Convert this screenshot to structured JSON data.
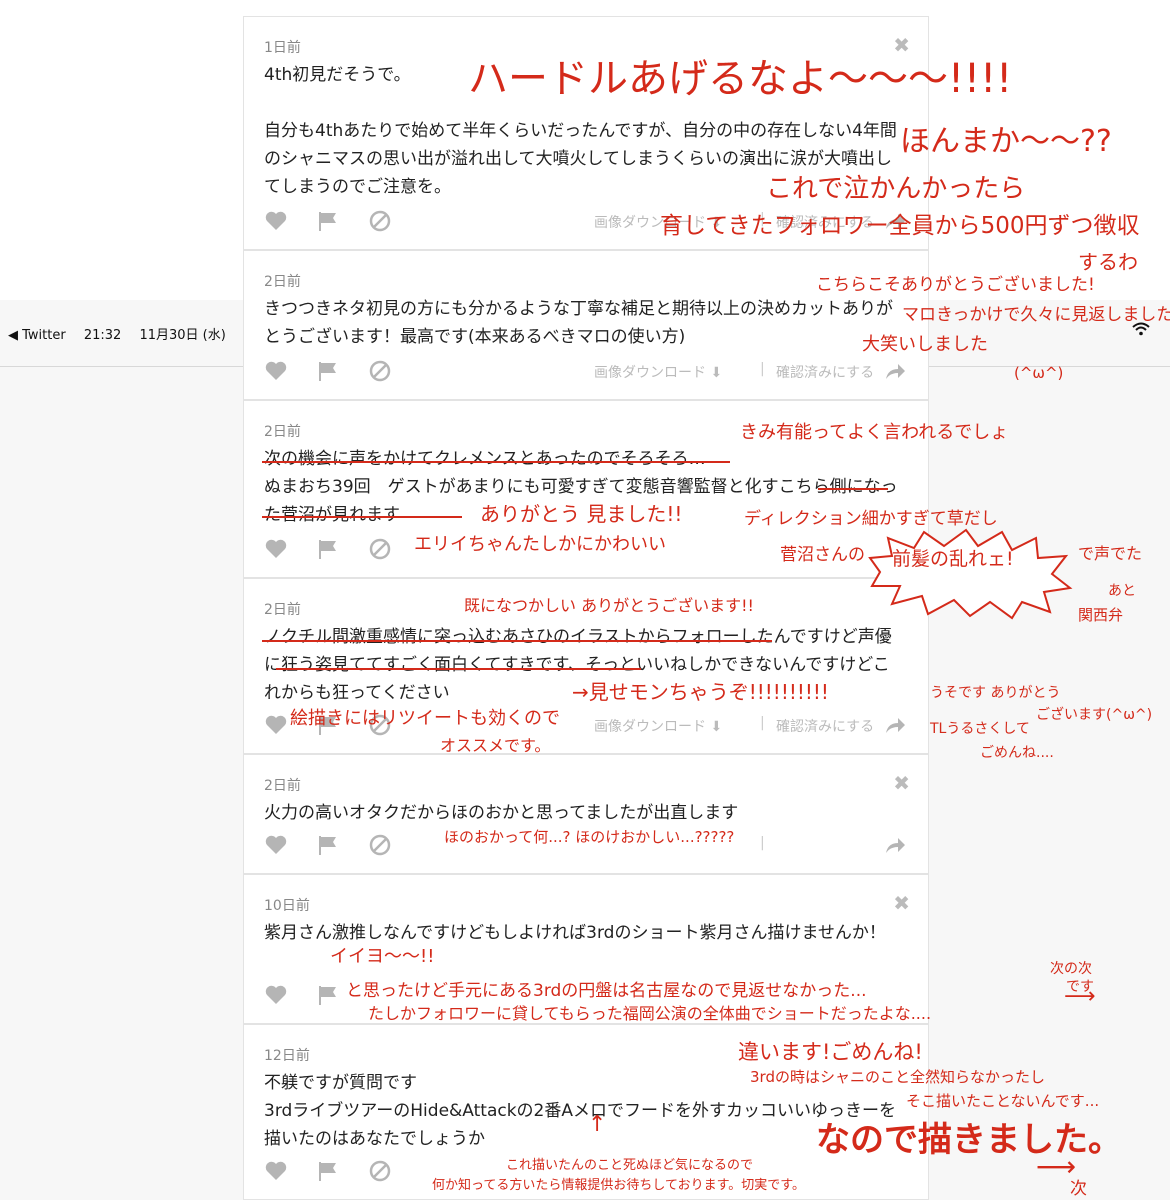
{
  "status_bar": {
    "back_app": "◀ Twitter",
    "time": "21:32",
    "date": "11月30日 (水)"
  },
  "action_labels": {
    "image_download": "画像ダウンロード",
    "mark_confirmed": "確認済みにする"
  },
  "cards": [
    {
      "time": "1日前",
      "body": "4th初見だそうで。\n\n自分も4thあたりで始めて半年くらいだったんですが、自分の中の存在しない4年間のシャニマスの思い出が溢れ出して大噴火してしまうくらいの演出に涙が大噴出してしまうのでご注意を。"
    },
    {
      "time": "2日前",
      "body": "きつつきネタ初見の方にも分かるような丁寧な補足と期待以上の決めカットありがとうございます！最高です(本来あるべきマロの使い方)"
    },
    {
      "time": "2日前",
      "body": "次の機会に声をかけてクレメンスとあったのでそろそろ…\nぬまおち39回　ゲストがあまりにも可愛すぎて変態音響監督と化すこちら側になった菅沼が見れます"
    },
    {
      "time": "2日前",
      "body": "ノクチル間激重感情に突っ込むあさひのイラストからフォローしたんですけど声優に狂う姿見ててすごく面白くてすきです、そっといいねしかできないんですけどこれからも狂ってください"
    },
    {
      "time": "2日前",
      "body": "火力の高いオタクだからほのおかと思ってましたが出直します"
    },
    {
      "time": "10日前",
      "body": "紫月さん激推しなんですけどもしよければ3rdのショート紫月さん描けませんか！"
    },
    {
      "time": "12日前",
      "body": "不躾ですが質問です\n3rdライブツアーのHide&Attackの2番Aメロでフードを外すカッコいいゆっきーを描いたのはあなたでしょうか"
    }
  ],
  "annotations": [
    "ハードルあげるなよ〜〜〜!!!!",
    "ほんまか〜〜??",
    "これで泣かんかったら",
    "育してきたフォロワー全員から500円ずつ徴収",
    "するわ",
    "こちらこそありがとうございました!",
    "マロきっかけで久々に見返しました",
    "大笑いしました",
    "(^ω^)",
    "きみ有能ってよく言われるでしょ",
    "ありがとう 見ました!!",
    "ディレクション細かすぎて草だし",
    "エリイちゃんたしかにかわいい",
    "菅沼さんの",
    "前髪の乱れェ!",
    "で声でた",
    "あと",
    "関西弁",
    "既になつかしい ありがとうございます!!",
    "→見せモンちゃうぞ!!!!!!!!!!",
    "うそです ありがとう",
    "ございます(^ω^)",
    "絵描きにはリツイートも効くので",
    "オススメです。",
    "TLうるさくして",
    "ごめんね....",
    "ほのおかって何...? ほのけおかしい...?????",
    "イイヨ〜〜!!",
    "と思ったけど手元にある3rdの円盤は名古屋なので見返せなかった...",
    "たしかフォロワーに貸してもらった福岡公演の全体曲でショートだったよな....",
    "次の次",
    "です",
    "違います!ごめんね!",
    "3rdの時はシャニのこと全然知らなかったし",
    "そこ描いたことないんです...",
    "なので描きました。",
    "これ描いたんのこと死ぬほど気になるので",
    "何か知ってる方いたら情報提供お待ちしております。切実です。",
    "次"
  ],
  "colors": {
    "annotation": "#d42a1a",
    "card_bg": "#ffffff",
    "feed_bg": "#f1f1f1",
    "icon_gray": "#b5b5b5"
  },
  "icons": [
    "heart-icon",
    "flag-icon",
    "ban-icon",
    "download-icon",
    "share-icon",
    "close-icon",
    "wifi-icon"
  ]
}
